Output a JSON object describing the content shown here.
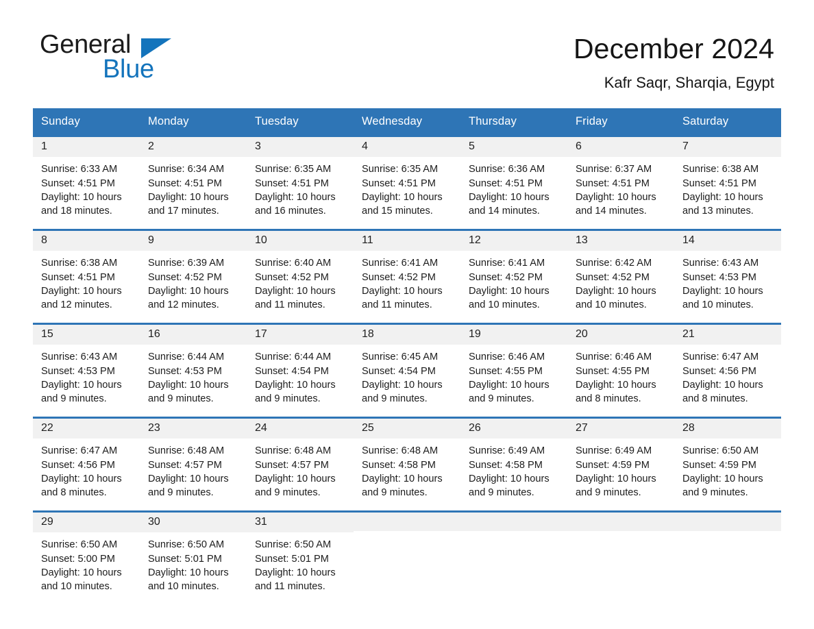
{
  "brand": {
    "name_part1": "General",
    "name_part2": "Blue",
    "triangle_color": "#1474BC"
  },
  "header": {
    "title": "December 2024",
    "subtitle": "Kafr Saqr, Sharqia, Egypt"
  },
  "theme": {
    "header_blue": "#2E75B6",
    "daynum_band": "#F1F1F1",
    "text": "#1c1c1c"
  },
  "weekdays": [
    "Sunday",
    "Monday",
    "Tuesday",
    "Wednesday",
    "Thursday",
    "Friday",
    "Saturday"
  ],
  "weeks": [
    [
      {
        "day": "1",
        "sunrise": "Sunrise: 6:33 AM",
        "sunset": "Sunset: 4:51 PM",
        "daylight_line1": "Daylight: 10 hours",
        "daylight_line2": "and 18 minutes."
      },
      {
        "day": "2",
        "sunrise": "Sunrise: 6:34 AM",
        "sunset": "Sunset: 4:51 PM",
        "daylight_line1": "Daylight: 10 hours",
        "daylight_line2": "and 17 minutes."
      },
      {
        "day": "3",
        "sunrise": "Sunrise: 6:35 AM",
        "sunset": "Sunset: 4:51 PM",
        "daylight_line1": "Daylight: 10 hours",
        "daylight_line2": "and 16 minutes."
      },
      {
        "day": "4",
        "sunrise": "Sunrise: 6:35 AM",
        "sunset": "Sunset: 4:51 PM",
        "daylight_line1": "Daylight: 10 hours",
        "daylight_line2": "and 15 minutes."
      },
      {
        "day": "5",
        "sunrise": "Sunrise: 6:36 AM",
        "sunset": "Sunset: 4:51 PM",
        "daylight_line1": "Daylight: 10 hours",
        "daylight_line2": "and 14 minutes."
      },
      {
        "day": "6",
        "sunrise": "Sunrise: 6:37 AM",
        "sunset": "Sunset: 4:51 PM",
        "daylight_line1": "Daylight: 10 hours",
        "daylight_line2": "and 14 minutes."
      },
      {
        "day": "7",
        "sunrise": "Sunrise: 6:38 AM",
        "sunset": "Sunset: 4:51 PM",
        "daylight_line1": "Daylight: 10 hours",
        "daylight_line2": "and 13 minutes."
      }
    ],
    [
      {
        "day": "8",
        "sunrise": "Sunrise: 6:38 AM",
        "sunset": "Sunset: 4:51 PM",
        "daylight_line1": "Daylight: 10 hours",
        "daylight_line2": "and 12 minutes."
      },
      {
        "day": "9",
        "sunrise": "Sunrise: 6:39 AM",
        "sunset": "Sunset: 4:52 PM",
        "daylight_line1": "Daylight: 10 hours",
        "daylight_line2": "and 12 minutes."
      },
      {
        "day": "10",
        "sunrise": "Sunrise: 6:40 AM",
        "sunset": "Sunset: 4:52 PM",
        "daylight_line1": "Daylight: 10 hours",
        "daylight_line2": "and 11 minutes."
      },
      {
        "day": "11",
        "sunrise": "Sunrise: 6:41 AM",
        "sunset": "Sunset: 4:52 PM",
        "daylight_line1": "Daylight: 10 hours",
        "daylight_line2": "and 11 minutes."
      },
      {
        "day": "12",
        "sunrise": "Sunrise: 6:41 AM",
        "sunset": "Sunset: 4:52 PM",
        "daylight_line1": "Daylight: 10 hours",
        "daylight_line2": "and 10 minutes."
      },
      {
        "day": "13",
        "sunrise": "Sunrise: 6:42 AM",
        "sunset": "Sunset: 4:52 PM",
        "daylight_line1": "Daylight: 10 hours",
        "daylight_line2": "and 10 minutes."
      },
      {
        "day": "14",
        "sunrise": "Sunrise: 6:43 AM",
        "sunset": "Sunset: 4:53 PM",
        "daylight_line1": "Daylight: 10 hours",
        "daylight_line2": "and 10 minutes."
      }
    ],
    [
      {
        "day": "15",
        "sunrise": "Sunrise: 6:43 AM",
        "sunset": "Sunset: 4:53 PM",
        "daylight_line1": "Daylight: 10 hours",
        "daylight_line2": "and 9 minutes."
      },
      {
        "day": "16",
        "sunrise": "Sunrise: 6:44 AM",
        "sunset": "Sunset: 4:53 PM",
        "daylight_line1": "Daylight: 10 hours",
        "daylight_line2": "and 9 minutes."
      },
      {
        "day": "17",
        "sunrise": "Sunrise: 6:44 AM",
        "sunset": "Sunset: 4:54 PM",
        "daylight_line1": "Daylight: 10 hours",
        "daylight_line2": "and 9 minutes."
      },
      {
        "day": "18",
        "sunrise": "Sunrise: 6:45 AM",
        "sunset": "Sunset: 4:54 PM",
        "daylight_line1": "Daylight: 10 hours",
        "daylight_line2": "and 9 minutes."
      },
      {
        "day": "19",
        "sunrise": "Sunrise: 6:46 AM",
        "sunset": "Sunset: 4:55 PM",
        "daylight_line1": "Daylight: 10 hours",
        "daylight_line2": "and 9 minutes."
      },
      {
        "day": "20",
        "sunrise": "Sunrise: 6:46 AM",
        "sunset": "Sunset: 4:55 PM",
        "daylight_line1": "Daylight: 10 hours",
        "daylight_line2": "and 8 minutes."
      },
      {
        "day": "21",
        "sunrise": "Sunrise: 6:47 AM",
        "sunset": "Sunset: 4:56 PM",
        "daylight_line1": "Daylight: 10 hours",
        "daylight_line2": "and 8 minutes."
      }
    ],
    [
      {
        "day": "22",
        "sunrise": "Sunrise: 6:47 AM",
        "sunset": "Sunset: 4:56 PM",
        "daylight_line1": "Daylight: 10 hours",
        "daylight_line2": "and 8 minutes."
      },
      {
        "day": "23",
        "sunrise": "Sunrise: 6:48 AM",
        "sunset": "Sunset: 4:57 PM",
        "daylight_line1": "Daylight: 10 hours",
        "daylight_line2": "and 9 minutes."
      },
      {
        "day": "24",
        "sunrise": "Sunrise: 6:48 AM",
        "sunset": "Sunset: 4:57 PM",
        "daylight_line1": "Daylight: 10 hours",
        "daylight_line2": "and 9 minutes."
      },
      {
        "day": "25",
        "sunrise": "Sunrise: 6:48 AM",
        "sunset": "Sunset: 4:58 PM",
        "daylight_line1": "Daylight: 10 hours",
        "daylight_line2": "and 9 minutes."
      },
      {
        "day": "26",
        "sunrise": "Sunrise: 6:49 AM",
        "sunset": "Sunset: 4:58 PM",
        "daylight_line1": "Daylight: 10 hours",
        "daylight_line2": "and 9 minutes."
      },
      {
        "day": "27",
        "sunrise": "Sunrise: 6:49 AM",
        "sunset": "Sunset: 4:59 PM",
        "daylight_line1": "Daylight: 10 hours",
        "daylight_line2": "and 9 minutes."
      },
      {
        "day": "28",
        "sunrise": "Sunrise: 6:50 AM",
        "sunset": "Sunset: 4:59 PM",
        "daylight_line1": "Daylight: 10 hours",
        "daylight_line2": "and 9 minutes."
      }
    ],
    [
      {
        "day": "29",
        "sunrise": "Sunrise: 6:50 AM",
        "sunset": "Sunset: 5:00 PM",
        "daylight_line1": "Daylight: 10 hours",
        "daylight_line2": "and 10 minutes."
      },
      {
        "day": "30",
        "sunrise": "Sunrise: 6:50 AM",
        "sunset": "Sunset: 5:01 PM",
        "daylight_line1": "Daylight: 10 hours",
        "daylight_line2": "and 10 minutes."
      },
      {
        "day": "31",
        "sunrise": "Sunrise: 6:50 AM",
        "sunset": "Sunset: 5:01 PM",
        "daylight_line1": "Daylight: 10 hours",
        "daylight_line2": "and 11 minutes."
      },
      {
        "day": "",
        "sunrise": "",
        "sunset": "",
        "daylight_line1": "",
        "daylight_line2": ""
      },
      {
        "day": "",
        "sunrise": "",
        "sunset": "",
        "daylight_line1": "",
        "daylight_line2": ""
      },
      {
        "day": "",
        "sunrise": "",
        "sunset": "",
        "daylight_line1": "",
        "daylight_line2": ""
      },
      {
        "day": "",
        "sunrise": "",
        "sunset": "",
        "daylight_line1": "",
        "daylight_line2": ""
      }
    ]
  ]
}
